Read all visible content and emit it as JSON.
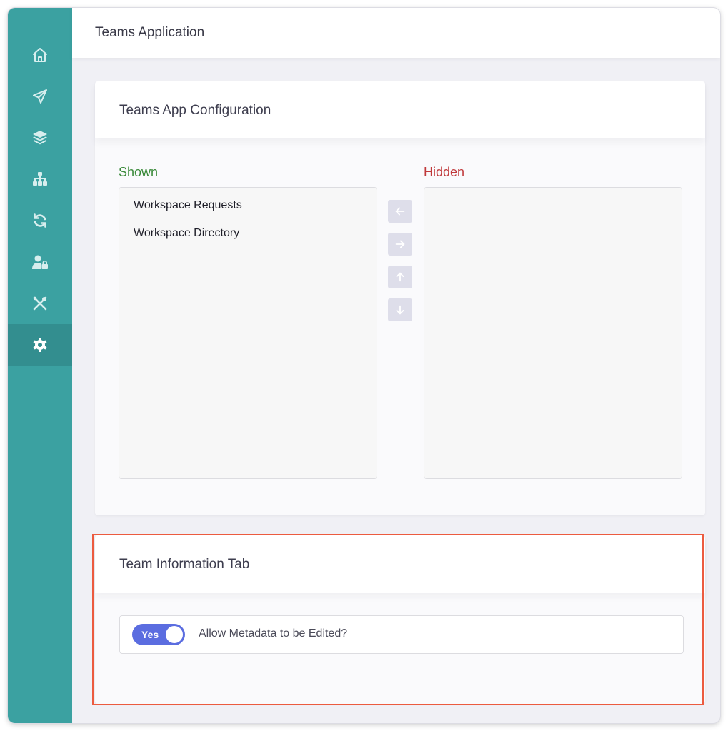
{
  "app": {
    "title": "Teams Application"
  },
  "sidebar": {
    "items": [
      {
        "icon": "home-icon",
        "active": false
      },
      {
        "icon": "paper-plane-icon",
        "active": false
      },
      {
        "icon": "layers-icon",
        "active": false
      },
      {
        "icon": "sitemap-icon",
        "active": false
      },
      {
        "icon": "sync-icon",
        "active": false
      },
      {
        "icon": "user-lock-icon",
        "active": false
      },
      {
        "icon": "tools-icon",
        "active": false
      },
      {
        "icon": "gear-icon",
        "active": true
      }
    ]
  },
  "config_card": {
    "title": "Teams App Configuration",
    "shown_label": "Shown",
    "hidden_label": "Hidden",
    "shown_items": [
      "Workspace Requests",
      "Workspace Directory"
    ],
    "hidden_items": [],
    "buttons": [
      "arrow-left-icon",
      "arrow-right-icon",
      "arrow-up-icon",
      "arrow-down-icon"
    ]
  },
  "team_info_card": {
    "title": "Team Information Tab",
    "toggle": {
      "state_label": "Yes",
      "on": true,
      "text": "Allow Metadata to be Edited?"
    }
  },
  "colors": {
    "sidebar": "#3ba1a1",
    "sidebar_active": "#338e8f",
    "shown_label": "#3a8a3a",
    "hidden_label": "#c0393b",
    "toggle_on": "#5b6de0",
    "highlight": "#ec5b3f",
    "arrow_button": "#dedeea"
  }
}
